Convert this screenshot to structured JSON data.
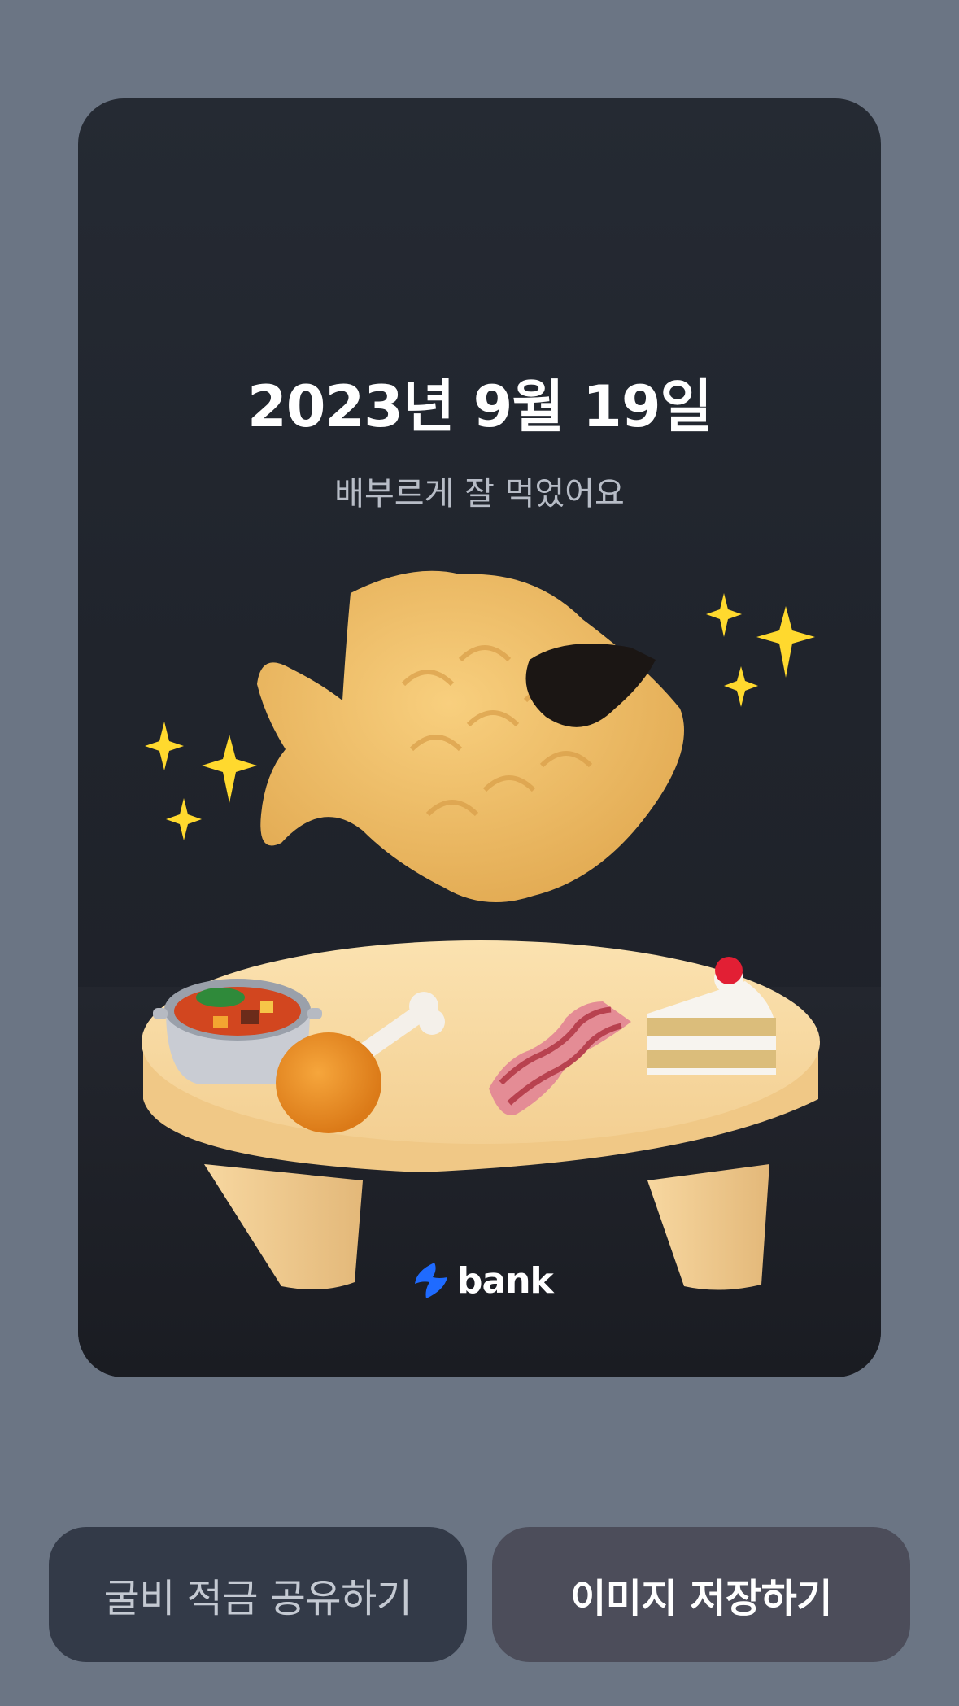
{
  "card": {
    "title": "2023년 9월 19일",
    "subtitle": "배부르게 잘 먹었어요"
  },
  "illustration": {
    "icons": [
      "fish-bread-icon",
      "sunglasses-icon",
      "sparkles-icon",
      "table-icon",
      "stew-pot-icon",
      "chicken-leg-icon",
      "bacon-icon",
      "cake-slice-icon"
    ]
  },
  "brand": {
    "logo": "toss-logo-icon",
    "name": "bank",
    "accent": "#1f6bff"
  },
  "buttons": {
    "share_label": "굴비 적금 공유하기",
    "save_label": "이미지 저장하기"
  },
  "colors": {
    "background": "#6b7584",
    "card": "#20242c",
    "share_button": "#333a48",
    "save_button": "#4c4d5a"
  }
}
